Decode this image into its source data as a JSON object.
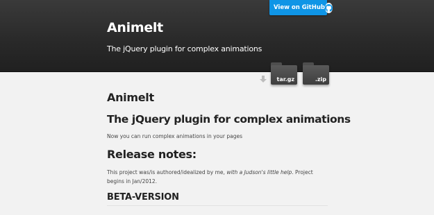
{
  "header": {
    "title": "Animelt",
    "tagline": "The jQuery plugin for complex animations",
    "github_button": "View on GitHub"
  },
  "downloads": {
    "tar_label": "tar.gz",
    "zip_label": ".zip"
  },
  "content": {
    "heading": "Animelt",
    "subheading": "The jQuery plugin for complex animations",
    "lead": "Now you can run complex animations in your pages",
    "release_heading": "Release notes:",
    "notes_before": "This project was/is authored/idealized by me, ",
    "notes_em": "with a Judson's little help",
    "notes_after": ". Project begins in Jan/2012.",
    "version_heading": "BETA-VERSION"
  },
  "colors": {
    "header_bg": "#2a2a2a",
    "github_accent": "#0f95e6",
    "page_bg": "#f2f2f2"
  }
}
